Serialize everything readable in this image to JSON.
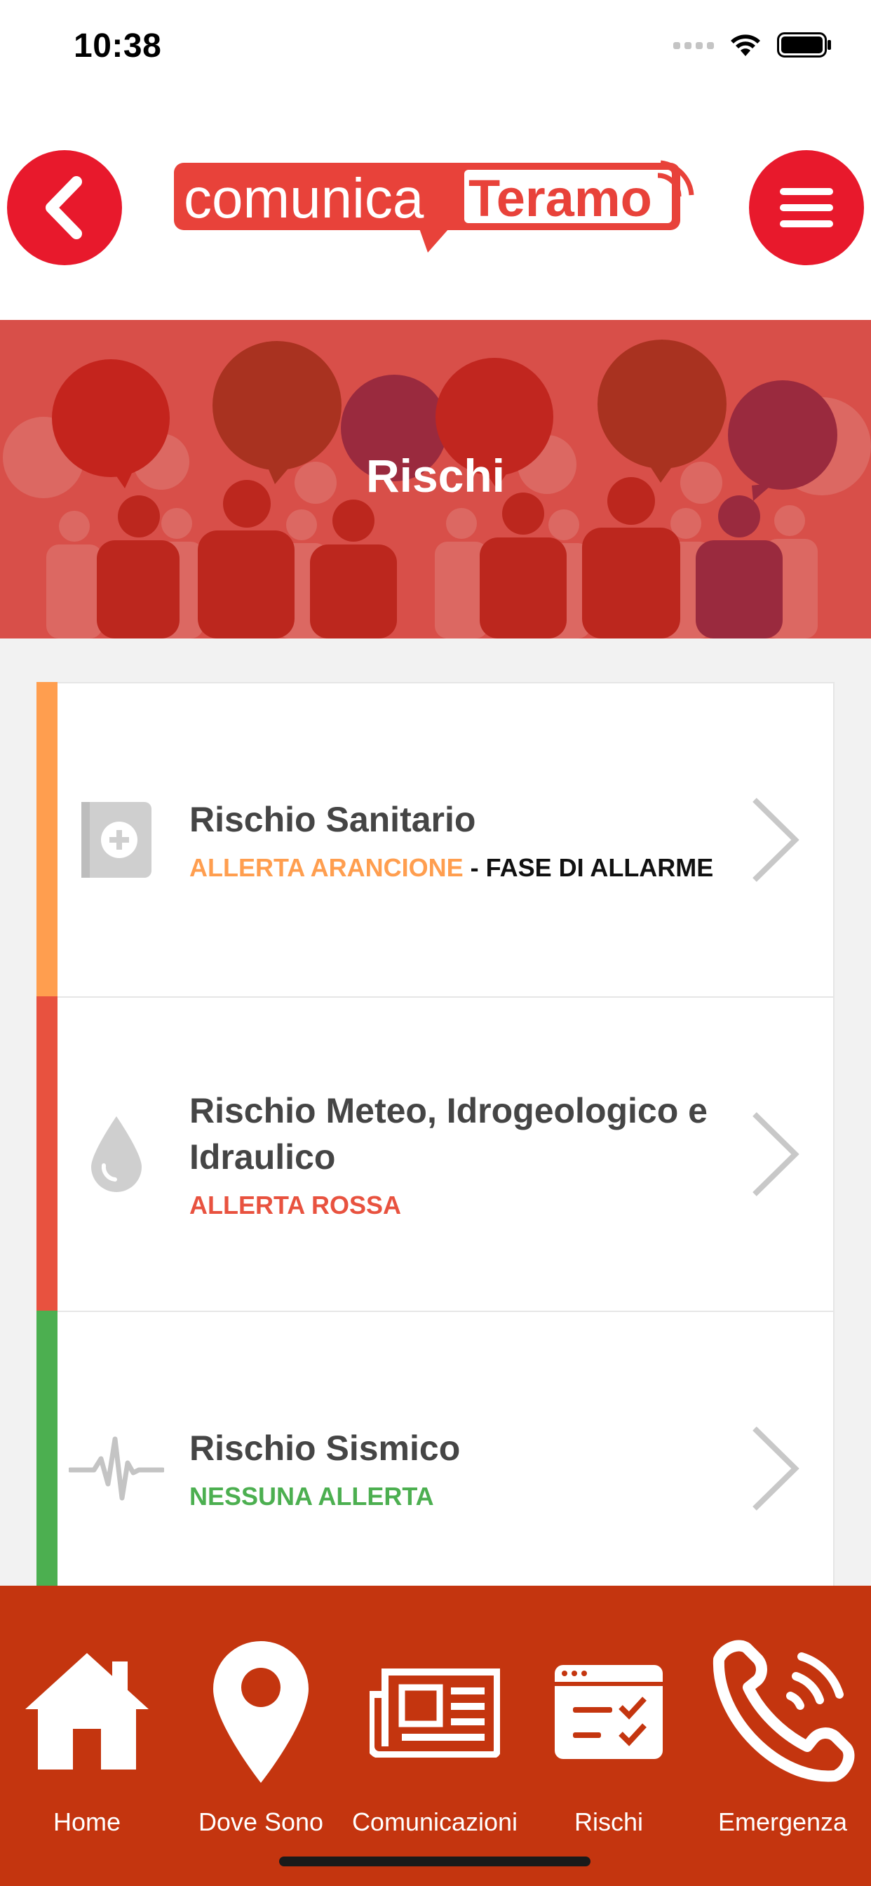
{
  "status_bar": {
    "time": "10:38",
    "icons": [
      "cellular-signal-icon",
      "wifi-icon",
      "battery-icon"
    ]
  },
  "header": {
    "back_icon": "chevron-left-icon",
    "menu_icon": "hamburger-menu-icon",
    "logo": {
      "part1": "comunica",
      "part2": "Teramo"
    }
  },
  "hero": {
    "title": "Rischi"
  },
  "risks": [
    {
      "title": "Rischio Sanitario",
      "status": "ALLERTA ARANCIONE",
      "phase": " - FASE DI ALLARME",
      "color": "#ff9e4f",
      "icon": "medical-kit-icon"
    },
    {
      "title": "Rischio Meteo, Idrogeologico e Idraulico",
      "status": "ALLERTA ROSSA",
      "phase": "",
      "color": "#e8523f",
      "icon": "water-drop-icon"
    },
    {
      "title": "Rischio Sismico",
      "status": "NESSUNA ALLERTA",
      "phase": "",
      "color": "#4caf50",
      "icon": "seismic-wave-icon"
    }
  ],
  "tabs": [
    {
      "label": "Home",
      "icon": "home-icon"
    },
    {
      "label": "Dove Sono",
      "icon": "location-pin-icon"
    },
    {
      "label": "Comunicazioni",
      "icon": "newspaper-icon"
    },
    {
      "label": "Rischi",
      "icon": "checklist-icon"
    },
    {
      "label": "Emergenza",
      "icon": "phone-call-icon"
    }
  ],
  "colors": {
    "brand_red": "#e8192c",
    "hero_bg": "#d84f49",
    "tab_bar_bg": "#c4350f"
  }
}
